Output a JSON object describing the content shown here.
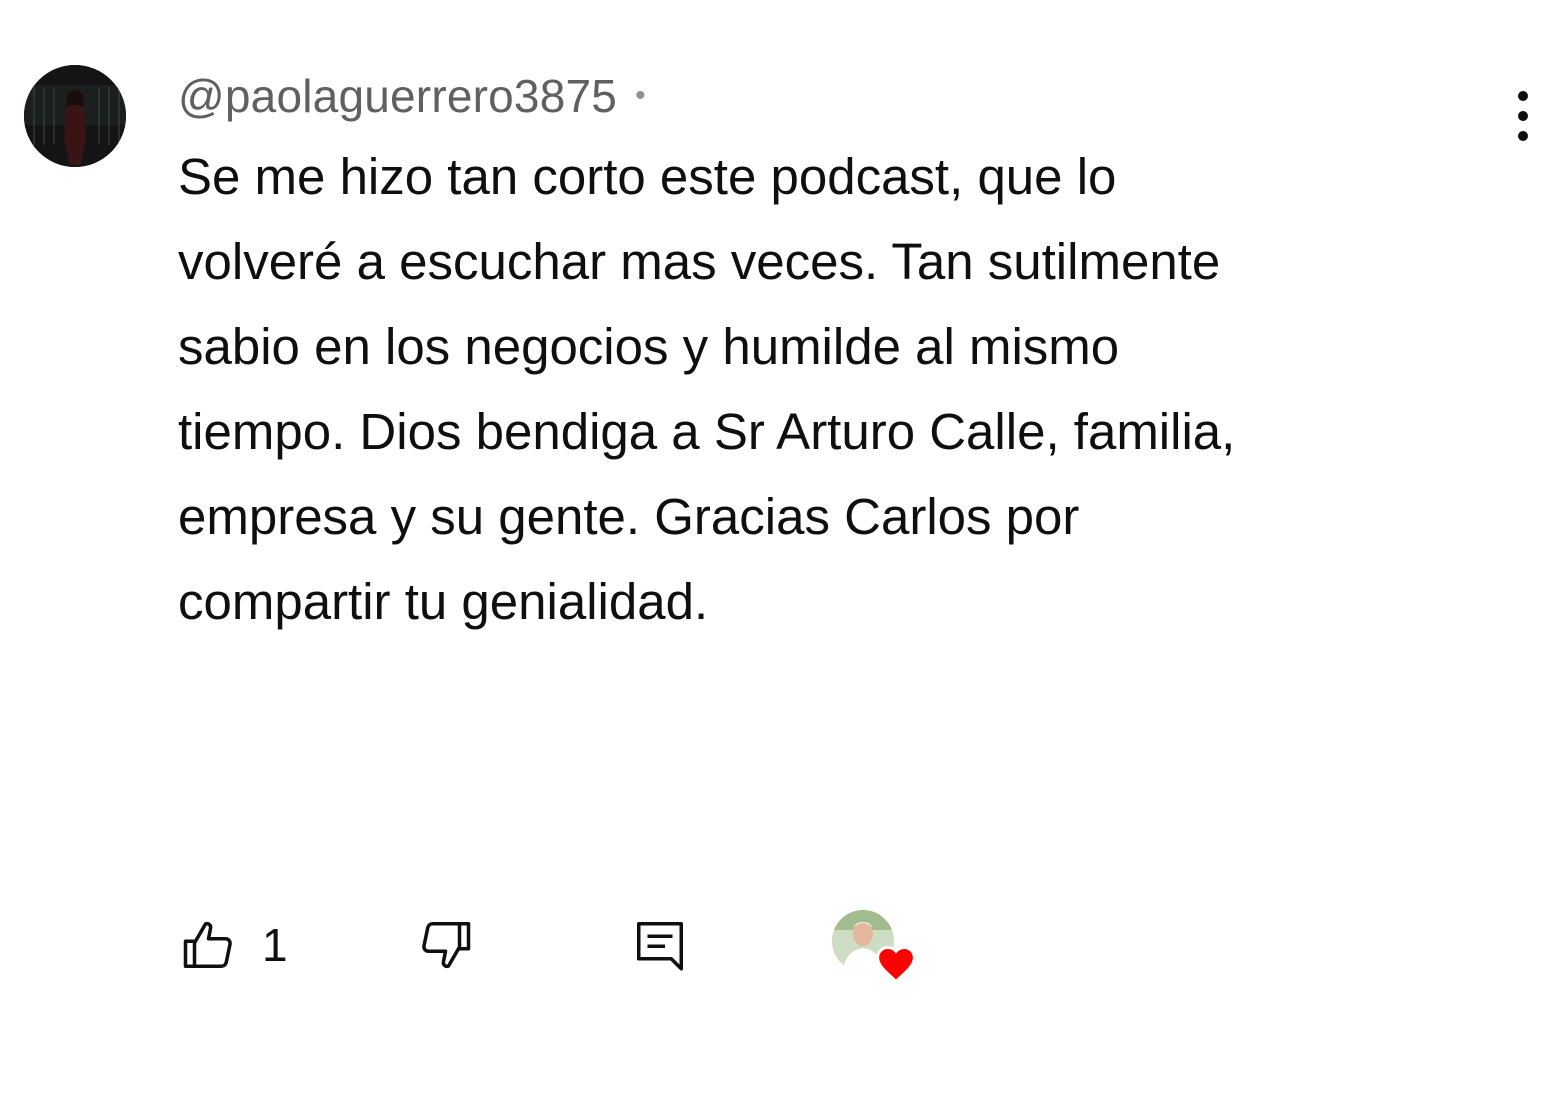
{
  "comment": {
    "author_handle": "@paolaguerrero3875",
    "separator": "•",
    "text": "Se me hizo tan corto este podcast, que lo\nvolveré a escuchar mas  veces. Tan sutilmente\nsabio en los negocios y humilde al mismo\ntiempo. Dios bendiga a  Sr Arturo Calle, familia,\nempresa y su gente.  Gracias Carlos por\ncompartir  tu genialidad."
  },
  "actions": {
    "like_count": "1"
  },
  "icons": {
    "avatar": "user-avatar",
    "more": "kebab-menu-icon",
    "like": "thumbs-up-icon",
    "dislike": "thumbs-down-icon",
    "reply": "reply-comment-icon",
    "creator_heart": "creator-heart-icon"
  },
  "colors": {
    "text": "#0f0f0f",
    "secondary_text": "#606060",
    "heart": "#ff0000"
  }
}
